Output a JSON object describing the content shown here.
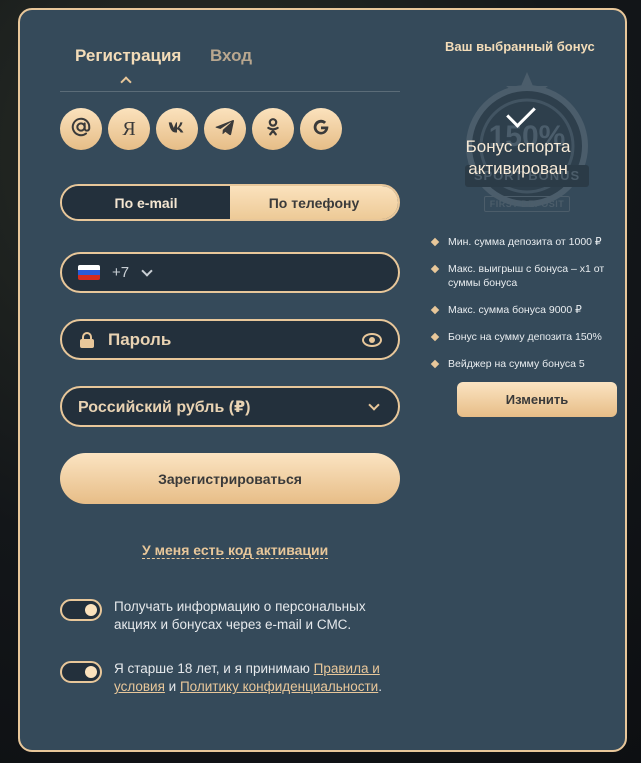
{
  "tabs": {
    "register": "Регистрация",
    "login": "Вход"
  },
  "social": [
    {
      "name": "email",
      "glyph": "@"
    },
    {
      "name": "yandex",
      "glyph": "Я"
    },
    {
      "name": "vk",
      "glyph": "vk"
    },
    {
      "name": "telegram",
      "glyph": "telegram"
    },
    {
      "name": "odnoklassniki",
      "glyph": "ok"
    },
    {
      "name": "google",
      "glyph": "G"
    }
  ],
  "method": {
    "email": "По e-mail",
    "phone": "По телефону",
    "selected": "phone"
  },
  "phone": {
    "code": "+7",
    "country": "RU",
    "value": "",
    "placeholder": ""
  },
  "password": {
    "placeholder": "Пароль"
  },
  "currency": {
    "selected": "Российский рубль (₽)"
  },
  "register_button": "Зарегистрироваться",
  "activation_link": "У меня есть код активации",
  "consent": {
    "promo_text": "Получать информацию о персональных акциях и бонусах через e-mail и СМС.",
    "age_prefix": "Я старше 18 лет, и я принимаю ",
    "rules_link": "Правила и условия",
    "and": " и ",
    "privacy_link": "Политику конфиденциальности",
    "dot": "."
  },
  "bonus": {
    "title": "Ваш выбранный бонус",
    "status_line1": "Бонус спорта",
    "status_line2": "активирован",
    "ribbon": "SPORT BONUS",
    "first_deposit": "FIRST DEPOSIT",
    "percent": "150%",
    "items": [
      "Мин. сумма депозита от 1000 ₽",
      "Макс. выигрыш с бонуса – x1 от суммы бонуса",
      "Макс. сумма бонуса 9000 ₽",
      "Бонус на сумму депозита 150%",
      "Вейджер на сумму бонуса 5"
    ],
    "change_button": "Изменить"
  },
  "colors": {
    "accent": "#e8c79a",
    "panel": "#354a5a",
    "field": "#23303c"
  }
}
